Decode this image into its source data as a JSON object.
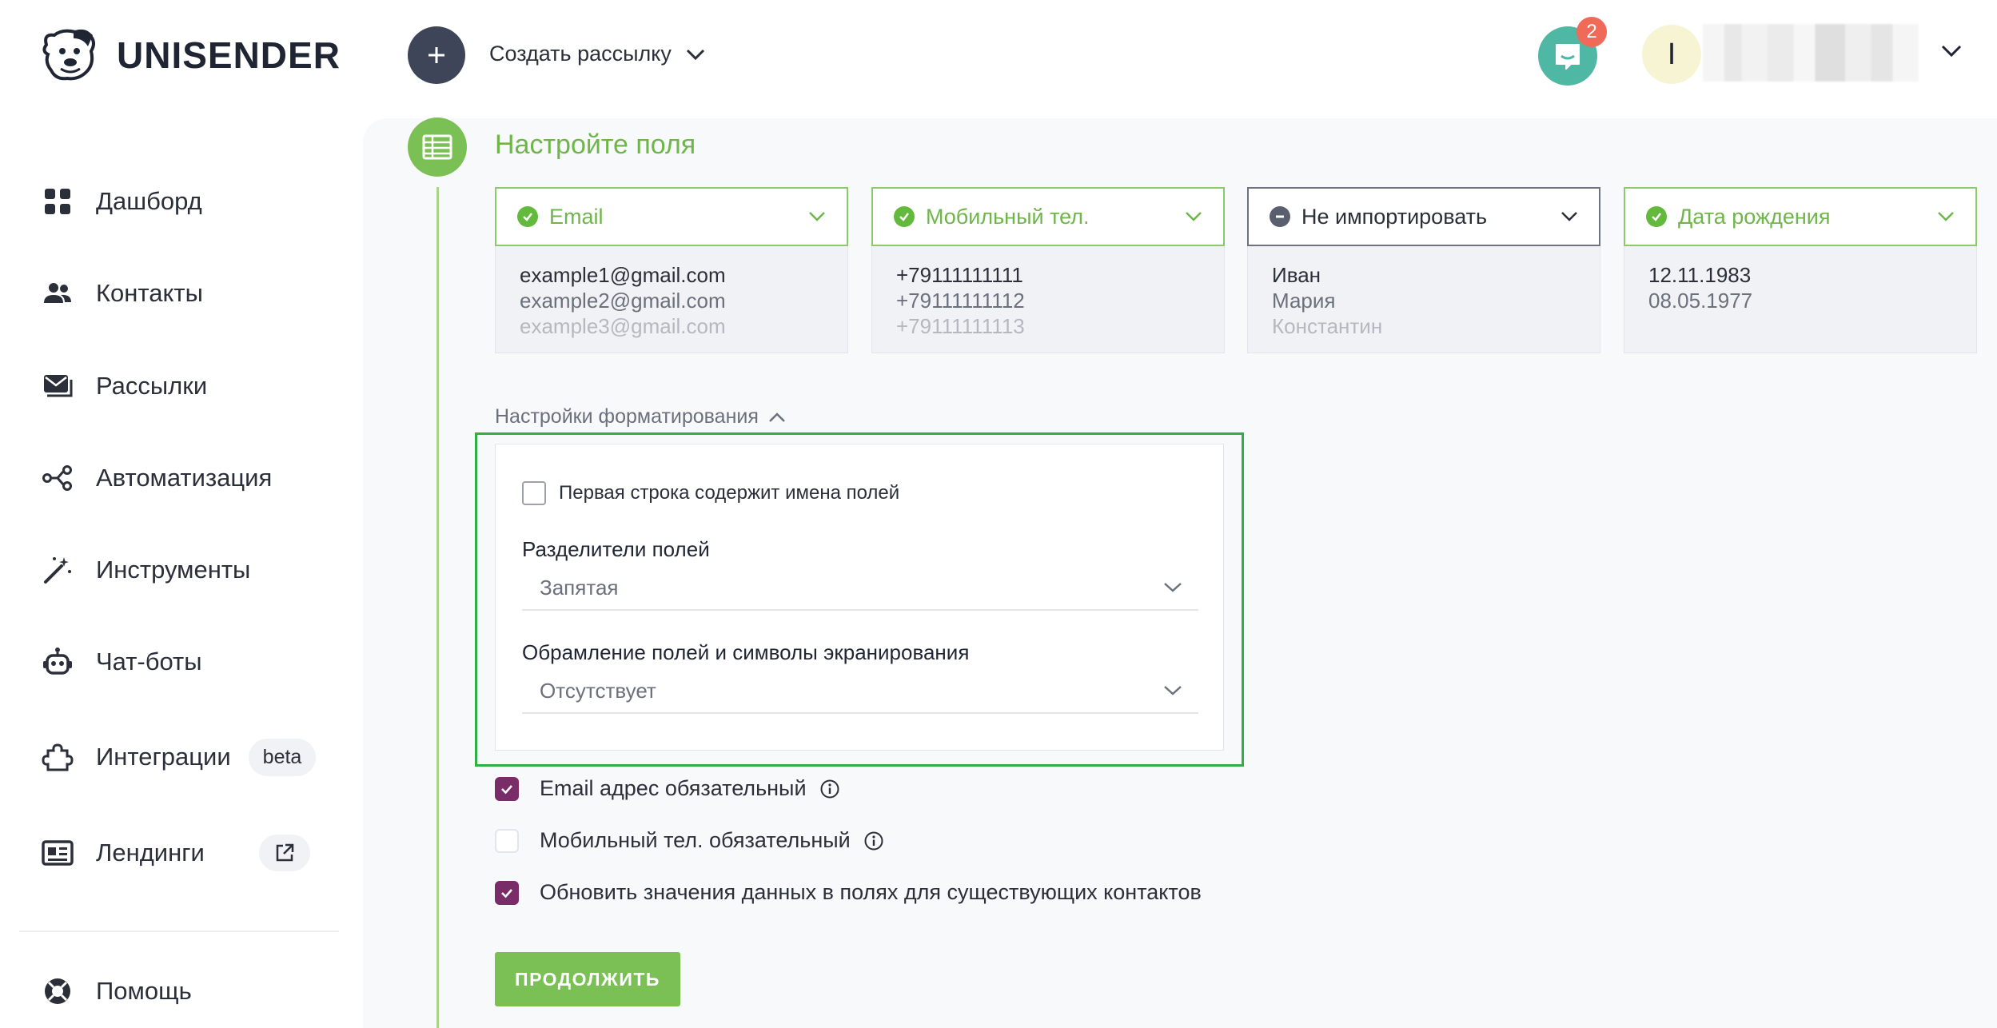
{
  "brand": {
    "name": "UNISENDER"
  },
  "sidebar": {
    "items": [
      {
        "label": "Дашборд",
        "icon": "dashboard-icon"
      },
      {
        "label": "Контакты",
        "icon": "contacts-icon"
      },
      {
        "label": "Рассылки",
        "icon": "mail-icon"
      },
      {
        "label": "Автоматизация",
        "icon": "automation-icon"
      },
      {
        "label": "Инструменты",
        "icon": "magic-wand-icon"
      },
      {
        "label": "Чат-боты",
        "icon": "robot-icon"
      },
      {
        "label": "Интеграции",
        "icon": "puzzle-icon",
        "badge": "beta"
      },
      {
        "label": "Лендинги",
        "icon": "landing-icon",
        "external": "external-link-icon"
      },
      {
        "label": "Помощь",
        "icon": "help-icon"
      }
    ]
  },
  "topbar": {
    "create_label": "Создать рассылку",
    "chat_badge": "2",
    "avatar_letter": "I"
  },
  "step": {
    "title": "Настройте поля",
    "columns": [
      {
        "header": "Email",
        "status": "ok",
        "values": [
          "example1@gmail.com",
          "example2@gmail.com",
          "example3@gmail.com"
        ]
      },
      {
        "header": "Мобильный тел.",
        "status": "ok",
        "values": [
          "+79111111111",
          "+79111111112",
          "+79111111113"
        ]
      },
      {
        "header": "Не импортировать",
        "status": "skip",
        "values": [
          "Иван",
          "Мария",
          "Константин"
        ]
      },
      {
        "header": "Дата рождения",
        "status": "ok",
        "values": [
          "12.11.1983",
          "08.05.1977",
          ""
        ]
      }
    ]
  },
  "formatting": {
    "toggle_label": "Настройки форматирования",
    "first_row_label": "Первая строка содержит имена полей",
    "first_row_checked": false,
    "separator_label": "Разделители полей",
    "separator_value": "Запятая",
    "quote_label": "Обрамление полей и символы экранирования",
    "quote_value": "Отсутствует"
  },
  "options": [
    {
      "label": "Email адрес обязательный",
      "checked": true,
      "info": true
    },
    {
      "label": "Мобильный тел. обязательный",
      "checked": false,
      "info": true
    },
    {
      "label": "Обновить значения данных в полях для существующих контактов",
      "checked": true,
      "info": false
    }
  ],
  "continue_label": "ПРОДОЛЖИТЬ",
  "colors": {
    "accent_green": "#7bc054",
    "check_purple": "#7a2c68",
    "highlight": "#2eb046"
  }
}
